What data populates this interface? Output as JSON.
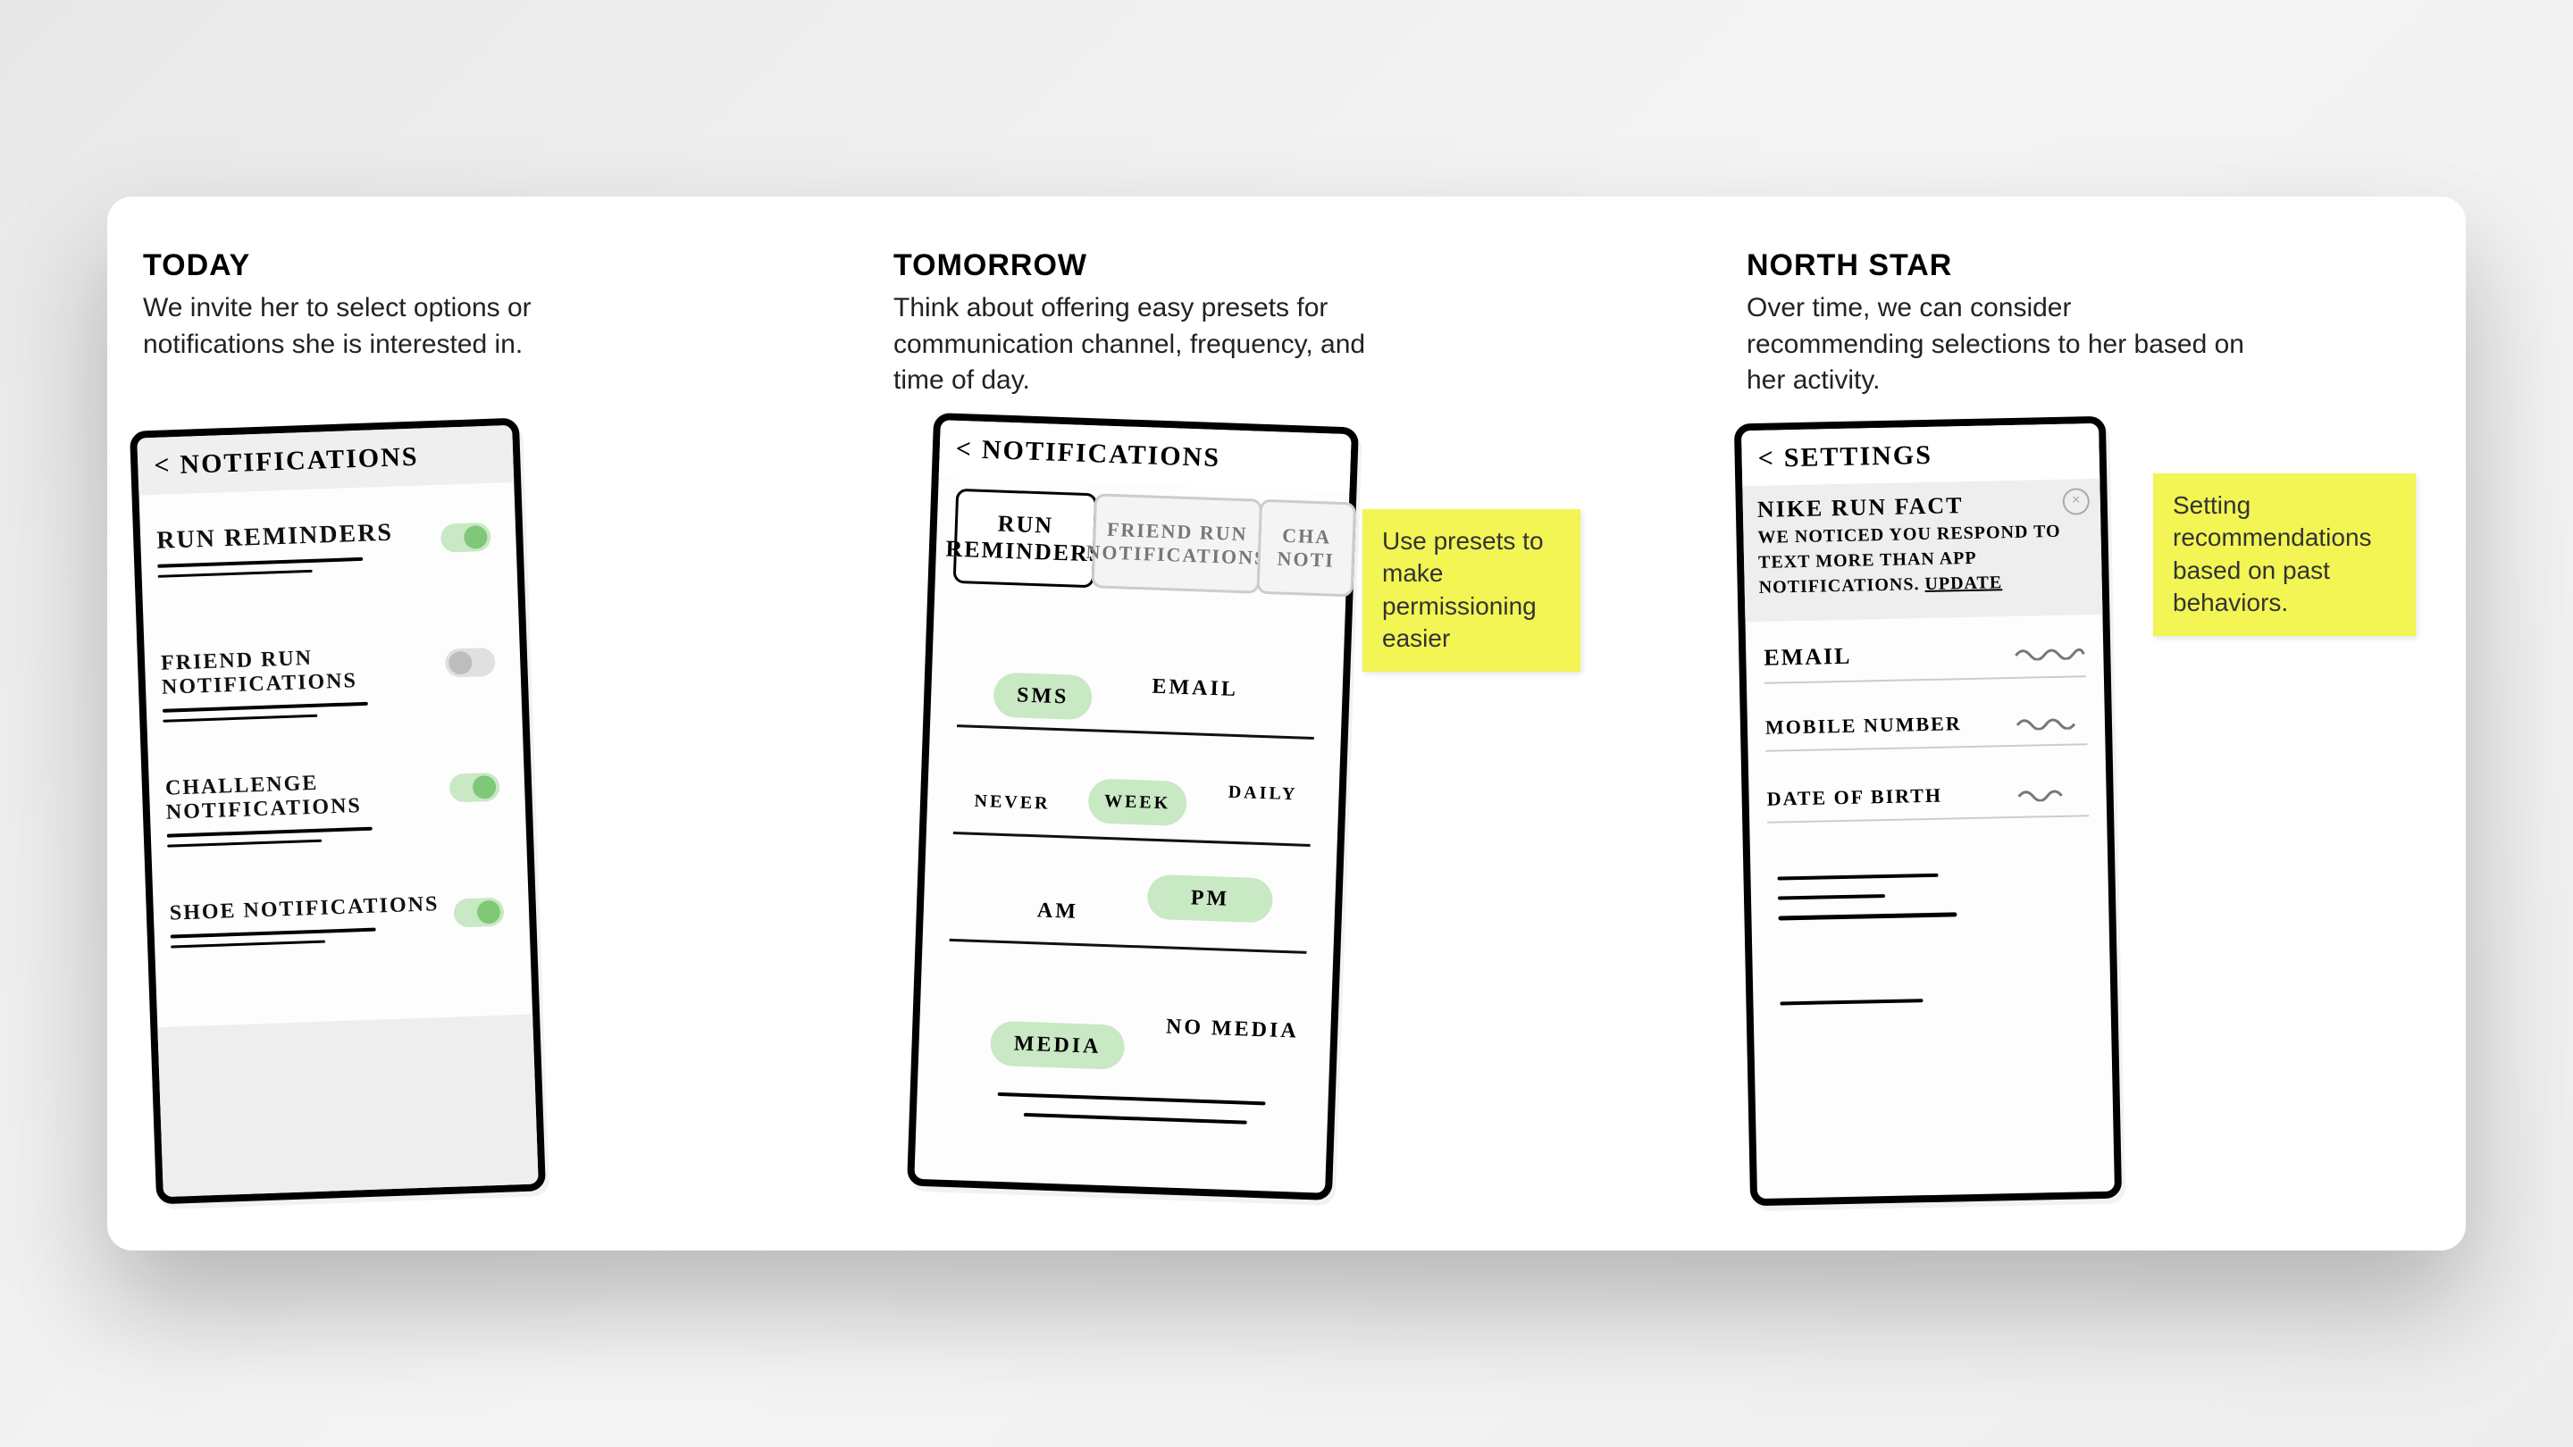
{
  "columns": {
    "today": {
      "title": "TODAY",
      "body": "We invite her to select options or notifications she is interested in."
    },
    "tomorrow": {
      "title": "TOMORROW",
      "body": "Think about offering easy presets for communication channel, frequency, and time of day."
    },
    "northstar": {
      "title": "NORTH STAR",
      "body": "Over time, we can consider recommending selections to her based on her activity."
    }
  },
  "sticky": {
    "presets": "Use presets to make permissioning easier",
    "recs": "Setting recommendations based on past behaviors."
  },
  "phoneA": {
    "header": "NOTIFICATIONS",
    "rows": [
      {
        "label": "RUN REMINDERS",
        "on": true
      },
      {
        "label": "FRIEND RUN NOTIFICATIONS",
        "on": false
      },
      {
        "label": "CHALLENGE NOTIFICATIONS",
        "on": true
      },
      {
        "label": "SHOE NOTIFICATIONS",
        "on": true
      }
    ]
  },
  "phoneB": {
    "header": "NOTIFICATIONS",
    "tabs": [
      "RUN REMINDERS",
      "FRIEND RUN NOTIFICATIONS",
      "CHA NOTI"
    ],
    "channel": {
      "options": [
        "SMS",
        "EMAIL"
      ],
      "selected": "SMS"
    },
    "freq": {
      "options": [
        "NEVER",
        "WEEK",
        "DAILY"
      ],
      "selected": "WEEK"
    },
    "tod": {
      "options": [
        "AM",
        "PM"
      ],
      "selected": "PM"
    },
    "media": {
      "options": [
        "MEDIA",
        "NO MEDIA"
      ],
      "selected": "MEDIA"
    }
  },
  "phoneC": {
    "header": "SETTINGS",
    "banner_title": "NIKE RUN FACT",
    "banner_body": "WE NOTICED YOU RESPOND TO TEXT MORE THAN APP NOTIFICATIONS.",
    "banner_cta": "UPDATE",
    "fields": [
      "EMAIL",
      "MOBILE NUMBER",
      "DATE OF BIRTH"
    ]
  }
}
